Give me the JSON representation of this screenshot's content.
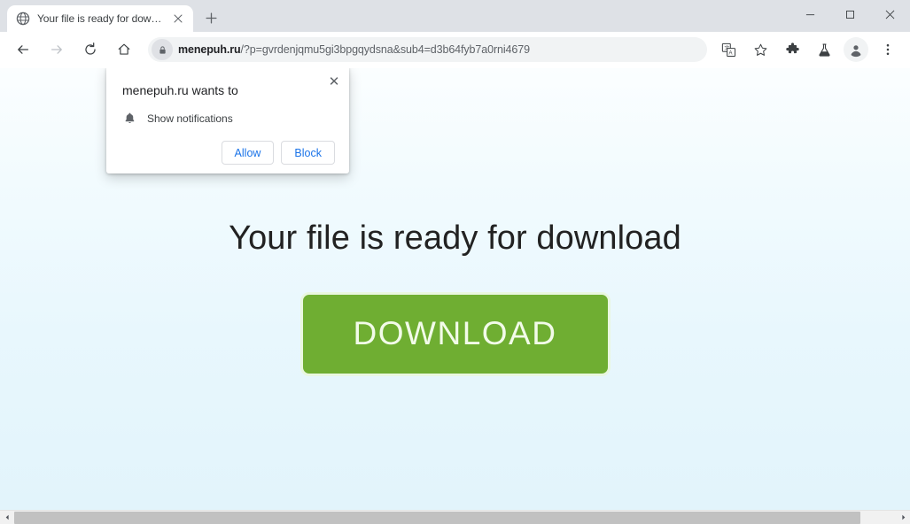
{
  "window": {
    "controls": [
      {
        "name": "minimize",
        "glyph": "—"
      },
      {
        "name": "maximize",
        "glyph": "□"
      },
      {
        "name": "close",
        "glyph": "✕"
      }
    ]
  },
  "tabs": [
    {
      "title": "Your file is ready for download",
      "favicon": "globe-icon",
      "close_label": "✕",
      "active": true
    }
  ],
  "newtab": {
    "label": "+",
    "icon": "plus-icon"
  },
  "toolbar": {
    "back": {
      "icon": "back-arrow-icon",
      "glyph": "←",
      "enabled": true
    },
    "forward": {
      "icon": "forward-arrow-icon",
      "glyph": "→",
      "enabled": false
    },
    "reload": {
      "icon": "reload-icon",
      "glyph": "⟳"
    },
    "home": {
      "icon": "home-icon",
      "glyph": "⌂"
    },
    "right_icons": [
      {
        "name": "translate-icon",
        "label": "Translate this page"
      },
      {
        "name": "bookmark-star-icon",
        "label": "Bookmark this tab"
      },
      {
        "name": "extensions-puzzle-icon",
        "label": "Extensions"
      },
      {
        "name": "flask-icon",
        "label": "Experiments"
      },
      {
        "name": "profile-avatar-icon",
        "label": "Profile"
      },
      {
        "name": "more-menu-icon",
        "label": "Customize and control Google Chrome"
      }
    ]
  },
  "omnibox": {
    "lock_icon": "lock-icon",
    "domain": "menepuh.ru",
    "path": "/?p=gvrdenjqmu5gi3bpgqydsna&sub4=d3b64fyb7a0rni4679",
    "full_url": "menepuh.ru/?p=gvrdenjqmu5gi3bpgqydsna&sub4=d3b64fyb7a0rni4679"
  },
  "permission_dialog": {
    "title": "menepuh.ru wants to",
    "permission_icon": "bell-icon",
    "permission_label": "Show notifications",
    "allow_label": "Allow",
    "block_label": "Block",
    "close_glyph": "✕"
  },
  "page": {
    "headline": "Your file is ready for download",
    "download_button_label": "DOWNLOAD",
    "colors": {
      "download_green": "#6fae32",
      "download_border": "#e9f7df",
      "download_text": "#f2fbe9",
      "bg_top": "#fbfeff",
      "bg_bottom": "#e2f4fb",
      "link_blue": "#1a73e8"
    }
  },
  "scrollbar": {
    "left_arrow": "◀",
    "right_arrow": "▶"
  }
}
